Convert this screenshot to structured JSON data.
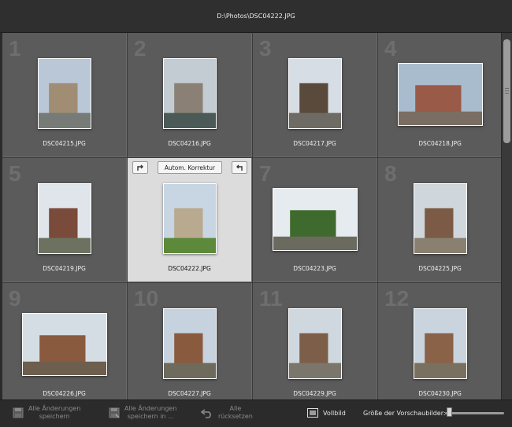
{
  "window": {
    "title": "D:\\Photos\\DSC04222.JPG"
  },
  "grid": {
    "thumbnails": [
      {
        "number": "1",
        "filename": "DSC04215.JPG",
        "orientation": "portrait",
        "sky": "#b9c7d6",
        "ground": "#777b78",
        "accent": "#a08d73"
      },
      {
        "number": "2",
        "filename": "DSC04216.JPG",
        "orientation": "portrait",
        "sky": "#c3ccd2",
        "ground": "#4c5a57",
        "accent": "#8a8076"
      },
      {
        "number": "3",
        "filename": "DSC04217.JPG",
        "orientation": "portrait",
        "sky": "#d7dde4",
        "ground": "#6e6a64",
        "accent": "#5a4a3c"
      },
      {
        "number": "4",
        "filename": "DSC04218.JPG",
        "orientation": "landscape",
        "sky": "#a9bccd",
        "ground": "#7a6e62",
        "accent": "#9a5a48"
      },
      {
        "number": "5",
        "filename": "DSC04219.JPG",
        "orientation": "portrait",
        "sky": "#dfe5ea",
        "ground": "#6d7260",
        "accent": "#7a4a3a"
      },
      {
        "number": "6",
        "filename": "DSC04222.JPG",
        "orientation": "portrait",
        "sky": "#c8d6e4",
        "ground": "#5c8a3a",
        "accent": "#b9a98e",
        "selected": true
      },
      {
        "number": "7",
        "filename": "DSC04223.JPG",
        "orientation": "landscape",
        "sky": "#e6ebef",
        "ground": "#6a6a5e",
        "accent": "#3f6a2d"
      },
      {
        "number": "8",
        "filename": "DSC04225.JPG",
        "orientation": "portrait",
        "sky": "#cfd7dd",
        "ground": "#8a8070",
        "accent": "#7b5b45"
      },
      {
        "number": "9",
        "filename": "DSC04226.JPG",
        "orientation": "landscape",
        "sky": "#d5dde4",
        "ground": "#6e5e4e",
        "accent": "#8a5a3e"
      },
      {
        "number": "10",
        "filename": "DSC04227.JPG",
        "orientation": "portrait",
        "sky": "#c6d3de",
        "ground": "#6e6a5c",
        "accent": "#8a5a3e"
      },
      {
        "number": "11",
        "filename": "DSC04229.JPG",
        "orientation": "portrait",
        "sky": "#d0d8df",
        "ground": "#7a766c",
        "accent": "#7d5e48"
      },
      {
        "number": "12",
        "filename": "DSC04230.JPG",
        "orientation": "portrait",
        "sky": "#c9d4de",
        "ground": "#7a7060",
        "accent": "#8a6248"
      }
    ],
    "overflow_row_filenames": [
      "DSC04226.JPG",
      "DSC04227.JPG",
      "DSC04229.JPG",
      "DSC04230.JPG"
    ]
  },
  "selected_tools": {
    "auto_correct_label": "Autom. Korrektur",
    "rotate_right_icon": "rotate-right-icon",
    "rotate_left_icon": "rotate-left-icon"
  },
  "footer": {
    "save_all_line1": "Alle Änderungen",
    "save_all_line2": "speichern",
    "save_all_as_line1": "Alle Änderungen",
    "save_all_as_line2": "speichern in ...",
    "reset_all_line1": "Alle",
    "reset_all_line2": "rücksetzen",
    "fullscreen_label": "Vollbild",
    "thumb_size_label": "Größe der Vorschaubilder:",
    "thumb_size_value": 0.03
  },
  "colors": {
    "cell_bg": "#5b5b5b",
    "selected_bg": "#dcdcdc",
    "app_bg": "#2b2b2b"
  }
}
